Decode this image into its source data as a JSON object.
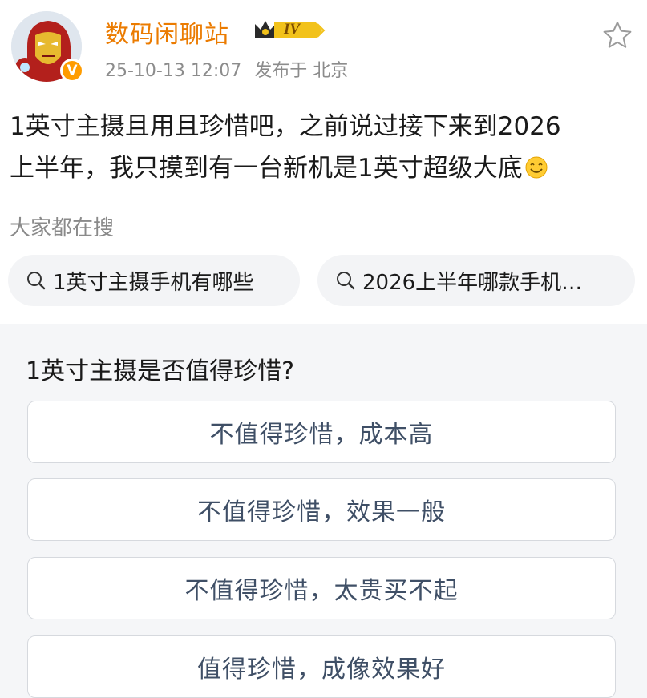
{
  "post": {
    "author": "数码闲聊站",
    "level_badge": "IV",
    "timestamp": "25-10-13 12:07",
    "location": "发布于 北京",
    "text_line1": "1英寸主摄且用且珍惜吧，之前说过接下来到2026",
    "text_line2": "上半年，我只摸到有一台新机是1英寸超级大底"
  },
  "search": {
    "title": "大家都在搜",
    "chips": [
      "1英寸主摄手机有哪些",
      "2026上半年哪款手机…"
    ]
  },
  "poll": {
    "question": "1英寸主摄是否值得珍惜?",
    "options": [
      "不值得珍惜，成本高",
      "不值得珍惜，效果一般",
      "不值得珍惜，太贵买不起",
      "值得珍惜，成像效果好"
    ]
  },
  "icons": {
    "verified": "verified-v-badge",
    "favorite": "star-icon",
    "search": "search-icon",
    "emoji": "smile-emoji"
  },
  "colors": {
    "author": "#eb7b00",
    "verified_badge": "#ff9c00",
    "poll_background": "#f5f6f8",
    "option_text": "#3f4f66"
  }
}
